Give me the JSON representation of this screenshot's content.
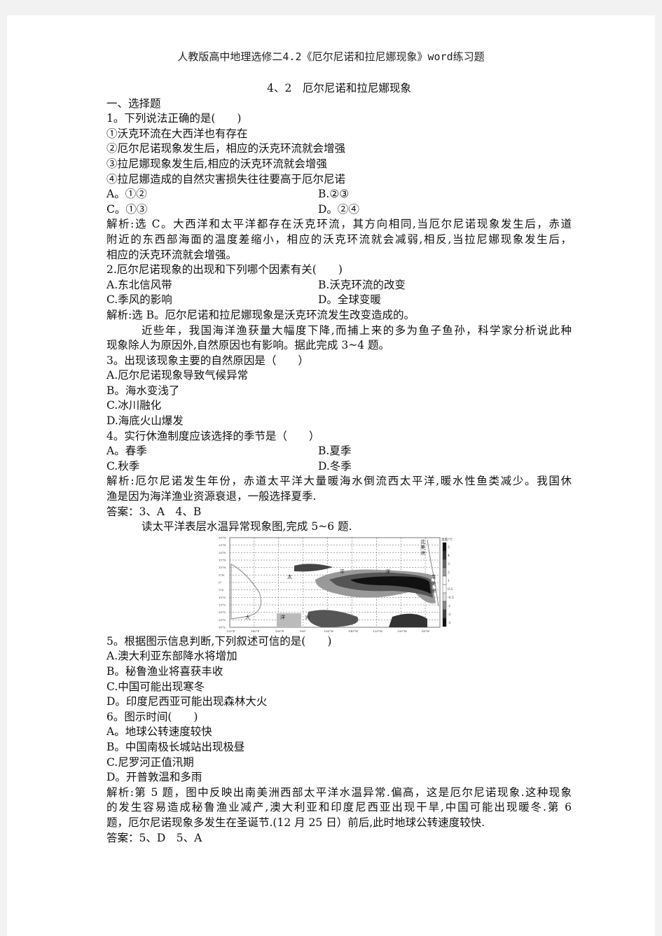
{
  "header": "人教版高中地理选修二4.2《厄尔尼诺和拉尼娜现象》word练习题",
  "title": "4、2　厄尔尼诺和拉尼娜现象",
  "section": "一、选择题",
  "q1": {
    "stem": "1。下列说法正确的是(　　)",
    "statements": [
      "①沃克环流在大西洋也有存在",
      "②厄尔尼诺现象发生后，相应的沃克环流就会增强",
      "③拉尼娜现象发生后,相应的沃克环流就会增强",
      "④拉尼娜造成的自然灾害损失往往要高于厄尔尼诺"
    ],
    "options": [
      "A。①②",
      "B.②③",
      "C。①③",
      "D。②④"
    ],
    "analysis": [
      "解析:选 C。大西洋和太平洋都存在沃克环流，其方向相同,当厄尔尼诺现象发生后，赤道",
      "附近的东西部海面的温度差缩小，相应的沃克环流就会减弱,相反,当拉尼娜现象发生后，",
      "相应的沃克环流就会增强。"
    ]
  },
  "q2": {
    "stem": "2.厄尔尼诺现象的出现和下列哪个因素有关(　　)",
    "options": [
      "A.东北信风带",
      "B.沃克环流的改变",
      "C.季风的影响",
      "D。全球变暖"
    ],
    "analysis": "解析:选 B。厄尔尼诺和拉尼娜现象是沃克环流发生改变造成的。"
  },
  "passage34": [
    "近些年，我国海洋渔获量大幅度下降,而捕上来的多为鱼子鱼孙，科学家分析说此种",
    "现象除人为原因外,自然原因也有影响。据此完成 3~4 题。"
  ],
  "q3": {
    "stem": "3。出现该现象主要的自然原因是（　　）",
    "options": [
      "A.厄尔尼诺现象导致气候异常",
      "B。海水变浅了",
      "C.冰川融化",
      "D.海底火山爆发"
    ]
  },
  "q4": {
    "stem": "4。实行休渔制度应该选择的季节是（　　）",
    "options": [
      "A。春季",
      "B.夏季",
      "C.秋季",
      "D.冬季"
    ],
    "analysis": [
      "解析:厄尔尼诺发生年份，赤道太平洋大量暖海水倒流西太平洋,暖水性鱼类减少。我国休",
      "渔是因为海洋渔业资源衰退，一般选择夏季."
    ],
    "answer": "答案：3、A　4、B"
  },
  "passage56": "读太平洋表层水温异常现象图,完成 5~6 题.",
  "map": {
    "lat_labels": [
      "30°N",
      "25°N",
      "20°N",
      "15°N",
      "10°N",
      "5°N",
      "0°",
      "5°S",
      "10°S",
      "15°S",
      "20°S",
      "25°S",
      "30°S"
    ],
    "lon_labels": [
      "120°E",
      "140°E",
      "160°E",
      "180°",
      "160°W",
      "140°W",
      "120°W",
      "100°W",
      "80°W"
    ],
    "legend_title": "温度/°C",
    "legend_values": [
      "5",
      "4",
      "3",
      "2",
      "1",
      "0.5",
      "-0.5",
      "-1",
      "-2",
      "-3"
    ],
    "legend_colors": [
      "#111111",
      "#333333",
      "#666666",
      "#999999",
      "#ffffff",
      "#ffffff",
      "#dddddd",
      "#888888",
      "#444444",
      "#111111"
    ],
    "place_labels": [
      "太",
      "平",
      "洋",
      "大",
      "洋",
      "洲",
      "北",
      "美",
      "洲",
      "南",
      "美",
      "洲"
    ]
  },
  "q5": {
    "stem": "5。根据图示信息判断,下列叙述可信的是(　　)",
    "options": [
      "A.澳大利亚东部降水将增加",
      "B。秘鲁渔业将喜获丰收",
      "C.中国可能出现寒冬",
      "D。印度尼西亚可能出现森林大火"
    ]
  },
  "q6": {
    "stem": "6。图示时间(　　)",
    "options": [
      "A。地球公转速度较快",
      "B。中国南极长城站出现极昼",
      "C.尼罗河正值汛期",
      "D。开普敦温和多雨"
    ]
  },
  "analysis56": [
    "解析:第 5 题，图中反映出南美洲西部太平洋水温异常.偏高，这是厄尔尼诺现象.这种现象",
    "的发生容易造成秘鲁渔业减产,澳大利亚和印度尼西亚出现干旱,中国可能出现暖冬.第 6",
    "题，厄尔尼诺现象多发生在圣诞节.(12 月 25 日）前后,此时地球公转速度较快."
  ],
  "answer56": "答案：5、D　5、A"
}
